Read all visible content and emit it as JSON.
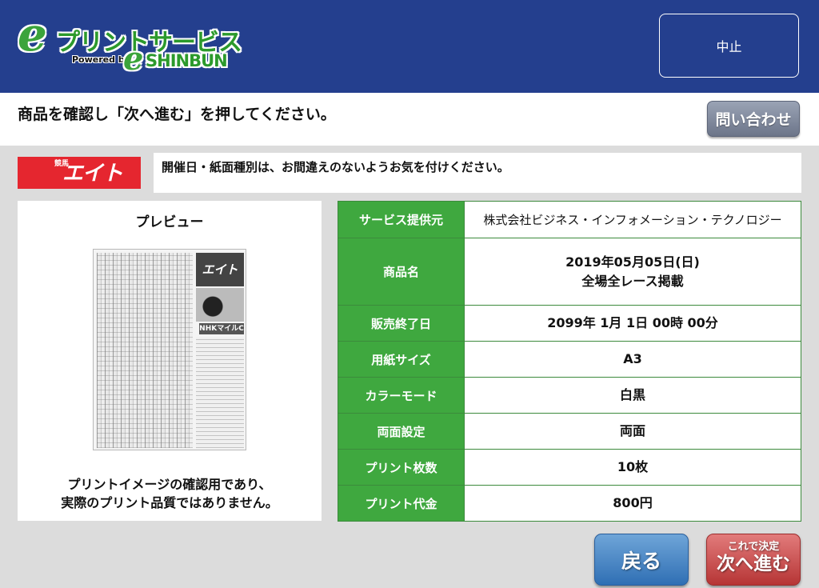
{
  "header": {
    "logo": {
      "mark": "e",
      "service_name": "プリントサービス",
      "powered_by": "Powered by",
      "partner_mark": "e",
      "partner_name": "SHINBUN"
    },
    "stop_label": "中止"
  },
  "instruction": {
    "text": "商品を確認し「次へ進む」を押してください。",
    "inquiry_label": "問い合わせ"
  },
  "paper": {
    "logo_small": "競馬",
    "logo_big": "エイト",
    "notice": "開催日・紙面種別は、お間違えのないようお気を付けください。"
  },
  "preview": {
    "title": "プレビュー",
    "thumb_mast": "エイト",
    "thumb_tag": "NHKマイルC",
    "caption_line1": "プリントイメージの確認用であり、",
    "caption_line2": "実際のプリント品質ではありません。"
  },
  "details": [
    {
      "label": "サービス提供元",
      "value": "株式会社ビジネス・インフォメーション・テクノロジー"
    },
    {
      "label": "商品名",
      "value": "2019年05月05日(日)",
      "value2": "全場全レース掲載"
    },
    {
      "label": "販売終了日",
      "value": "2099年 1月 1日 00時 00分"
    },
    {
      "label": "用紙サイズ",
      "value": "A3"
    },
    {
      "label": "カラーモード",
      "value": "白黒"
    },
    {
      "label": "両面設定",
      "value": "両面"
    },
    {
      "label": "プリント枚数",
      "value": "10枚"
    },
    {
      "label": "プリント代金",
      "value": "800円"
    }
  ],
  "footer": {
    "back_label": "戻る",
    "next_small_label": "これで決定",
    "next_label": "次へ進む"
  },
  "colors": {
    "header_bg": "#243f8e",
    "label_green": "#3fa83f",
    "back_blue": "#2f6fb4",
    "next_red": "#b63535"
  }
}
